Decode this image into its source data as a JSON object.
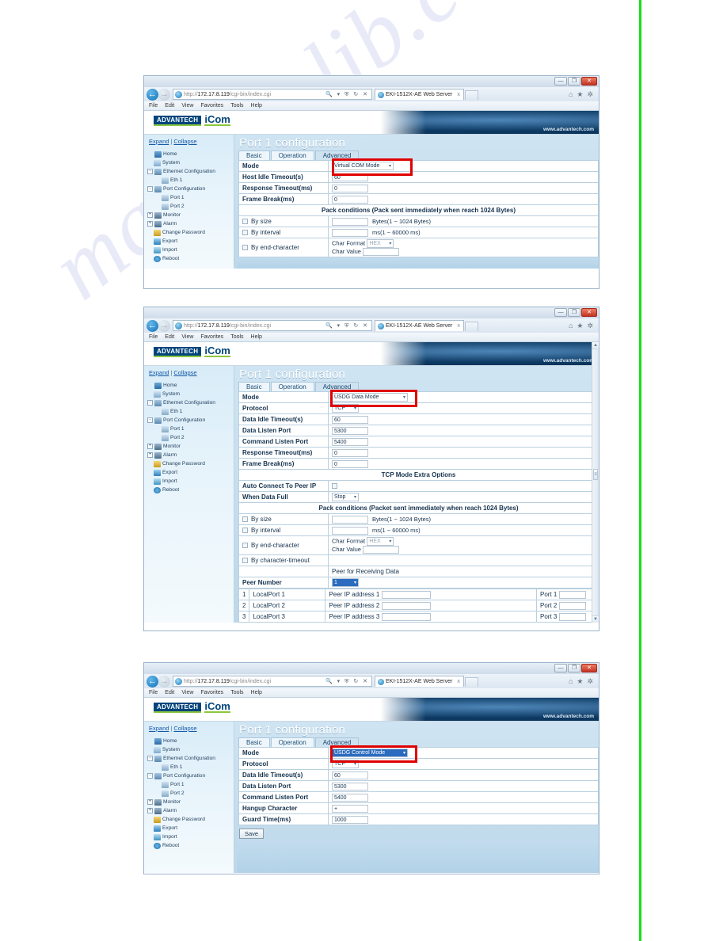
{
  "page": {
    "watermark": "manualslib.com",
    "accent_green": "#18e018",
    "highlight_color": "#e00000"
  },
  "browser": {
    "url_protocol": "http://",
    "url_host": "172.17.8.119",
    "url_path": "/cgi-bin/index.cgi",
    "tab_title": "EKI-1512X-AE Web Server",
    "tab_close": "x",
    "menu": [
      "File",
      "Edit",
      "View",
      "Favorites",
      "Tools",
      "Help"
    ],
    "window_buttons": {
      "minimize": "—",
      "maximize": "❐",
      "close": "✕"
    },
    "address_icons": "🔍 ▾ ⛨ ↻ ✕",
    "toolbar_icons": [
      "home-icon",
      "favorites-icon",
      "settings-icon"
    ],
    "nav": {
      "back": "←",
      "forward": "→"
    }
  },
  "brand": {
    "logo_primary": "ADVANTECH",
    "logo_secondary": "iCom",
    "website": "www.advantech.com"
  },
  "sidebar": {
    "expand": "Expand",
    "separator": "|",
    "collapse": "Collapse",
    "items": [
      {
        "label": "Home",
        "level": 0,
        "icon": "home-icon",
        "toggle": ""
      },
      {
        "label": "System",
        "level": 1,
        "icon": "document-icon",
        "toggle": ""
      },
      {
        "label": "Ethernet Configuration",
        "level": 0,
        "icon": "folder-icon",
        "toggle": "-"
      },
      {
        "label": "Eth 1",
        "level": 2,
        "icon": "port-icon",
        "toggle": ""
      },
      {
        "label": "Port Configuration",
        "level": 0,
        "icon": "folder-icon",
        "toggle": "-"
      },
      {
        "label": "Port 1",
        "level": 2,
        "icon": "port-icon",
        "toggle": ""
      },
      {
        "label": "Port 2",
        "level": 2,
        "icon": "port-icon",
        "toggle": ""
      },
      {
        "label": "Monitor",
        "level": 0,
        "icon": "monitor-icon",
        "toggle": "+"
      },
      {
        "label": "Alarm",
        "level": 0,
        "icon": "monitor-icon",
        "toggle": "+"
      },
      {
        "label": "Change Password",
        "level": 1,
        "icon": "key-icon",
        "toggle": ""
      },
      {
        "label": "Export",
        "level": 1,
        "icon": "export-icon",
        "toggle": ""
      },
      {
        "label": "Import",
        "level": 1,
        "icon": "import-icon",
        "toggle": ""
      },
      {
        "label": "Reboot",
        "level": 1,
        "icon": "reboot-icon",
        "toggle": ""
      }
    ]
  },
  "common": {
    "page_title": "Port 1 configuration",
    "tabs": [
      "Basic",
      "Operation",
      "Advanced"
    ],
    "active_tab": "Advanced",
    "save_label": "Save",
    "caret": "▾"
  },
  "screen1": {
    "mode_label": "Mode",
    "mode_value": "Virtual COM Mode",
    "rows": [
      {
        "label": "Host Idle Timeout(s)",
        "value": "60"
      },
      {
        "label": "Response Timeout(ms)",
        "value": "0"
      },
      {
        "label": "Frame Break(ms)",
        "value": "0"
      }
    ],
    "pack_header": "Pack conditions (Pack sent immediately when reach 1024 Bytes)",
    "by_size": "By size",
    "by_size_hint": "Bytes(1 ~ 1024 Bytes)",
    "by_interval": "By interval",
    "by_interval_hint": "ms(1 ~ 60000 ms)",
    "by_end_character": "By end-character",
    "char_format_label": "Char Format",
    "char_format_value": "HEX",
    "char_value_label": "Char Value",
    "char_value": ""
  },
  "screen2": {
    "mode_label": "Mode",
    "mode_value": "USDG Data Mode",
    "protocol_label": "Protocol",
    "protocol_value": "TCP",
    "rows": [
      {
        "label": "Data Idle Timeout(s)",
        "value": "60"
      },
      {
        "label": "Data Listen Port",
        "value": "5300"
      },
      {
        "label": "Command Listen Port",
        "value": "5400"
      },
      {
        "label": "Response Timeout(ms)",
        "value": "0"
      },
      {
        "label": "Frame Break(ms)",
        "value": "0"
      }
    ],
    "tcp_extra_header": "TCP Mode Extra Options",
    "auto_connect_label": "Auto Connect To Peer IP",
    "when_data_full_label": "When Data Full",
    "when_data_full_value": "Stop",
    "pack_header": "Pack conditions (Packet sent immediately when reach 1024 Bytes)",
    "by_size": "By size",
    "by_size_hint": "Bytes(1 ~ 1024 Bytes)",
    "by_interval": "By interval",
    "by_interval_hint": "ms(1 ~ 60000 ms)",
    "by_end_character": "By end-character",
    "by_character_timeout": "By character-timeout",
    "char_format_label": "Char Format",
    "char_format_value": "HEX",
    "char_value_label": "Char Value",
    "char_value": "",
    "peer_section_header": "Peer for Receiving Data",
    "peer_number_label": "Peer Number",
    "peer_number_value": "1",
    "peer_rows": [
      {
        "index": "1",
        "local": "LocalPort 1",
        "peer_ip": "Peer IP address 1",
        "port": "Port 1"
      },
      {
        "index": "2",
        "local": "LocalPort 2",
        "peer_ip": "Peer IP address 2",
        "port": "Port 2"
      },
      {
        "index": "3",
        "local": "LocalPort 3",
        "peer_ip": "Peer IP address 3",
        "port": "Port 3"
      }
    ],
    "scrollbar": {
      "up": "▲",
      "down": "▼",
      "grip": "≡"
    }
  },
  "screen3": {
    "mode_label": "Mode",
    "mode_value": "USDG Control Mode",
    "protocol_label": "Protocol",
    "protocol_value": "TCP",
    "rows": [
      {
        "label": "Data Idle Timeout(s)",
        "value": "60"
      },
      {
        "label": "Data Listen Port",
        "value": "5300"
      },
      {
        "label": "Command Listen Port",
        "value": "5400"
      },
      {
        "label": "Hangup Character",
        "value": "+"
      },
      {
        "label": "Guard Time(ms)",
        "value": "1000"
      }
    ],
    "save_label": "Save"
  }
}
